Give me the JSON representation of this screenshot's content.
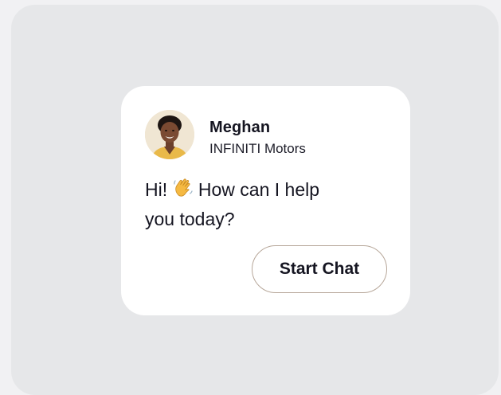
{
  "agent": {
    "name": "Meghan",
    "company": "INFINITI Motors",
    "avatar_icon": "person-avatar"
  },
  "message": {
    "greeting_before": "Hi! ",
    "emoji_icon": "waving-hand-icon",
    "greeting_after": " How can I help you today?"
  },
  "actions": {
    "start_chat_label": "Start Chat"
  },
  "colors": {
    "page_background": "#e6e7e9",
    "card_background": "#ffffff",
    "text": "#151521",
    "button_border": "#b7a79a"
  }
}
